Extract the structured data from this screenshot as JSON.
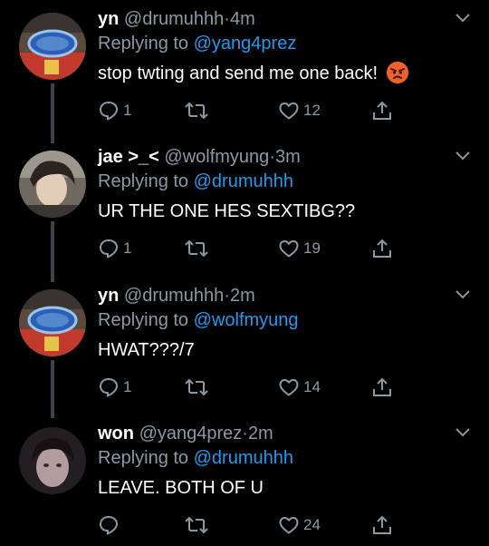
{
  "tweets": [
    {
      "name": "yn",
      "handle": "@drumuhhh",
      "sep": "·",
      "time": "4m",
      "reply_prefix": "Replying to",
      "reply_to": "@yang4prez",
      "text": "stop twting and send me one back!",
      "emoji": "angry-face",
      "replies": "1",
      "retweets": "",
      "likes": "12"
    },
    {
      "name": "jae >_<",
      "handle": "@wolfmyung",
      "sep": "·",
      "time": "3m",
      "reply_prefix": "Replying to",
      "reply_to": "@drumuhhh",
      "text": "UR THE ONE HES SEXTIBG??",
      "replies": "1",
      "retweets": "",
      "likes": "19"
    },
    {
      "name": "yn",
      "handle": "@drumuhhh",
      "sep": "·",
      "time": "2m",
      "reply_prefix": "Replying to",
      "reply_to": "@wolfmyung",
      "text": "HWAT???/7",
      "replies": "1",
      "retweets": "",
      "likes": "14"
    },
    {
      "name": "won",
      "handle": "@yang4prez",
      "sep": "·",
      "time": "2m",
      "reply_prefix": "Replying to",
      "reply_to": "@drumuhhh",
      "text": "LEAVE. BOTH OF U",
      "replies": "",
      "retweets": "",
      "likes": "24"
    }
  ],
  "colors": {
    "background": "#000000",
    "text": "#ffffff",
    "secondary": "#8b98a5",
    "mention": "#1d9bf0",
    "thread_line": "#3d4348"
  }
}
